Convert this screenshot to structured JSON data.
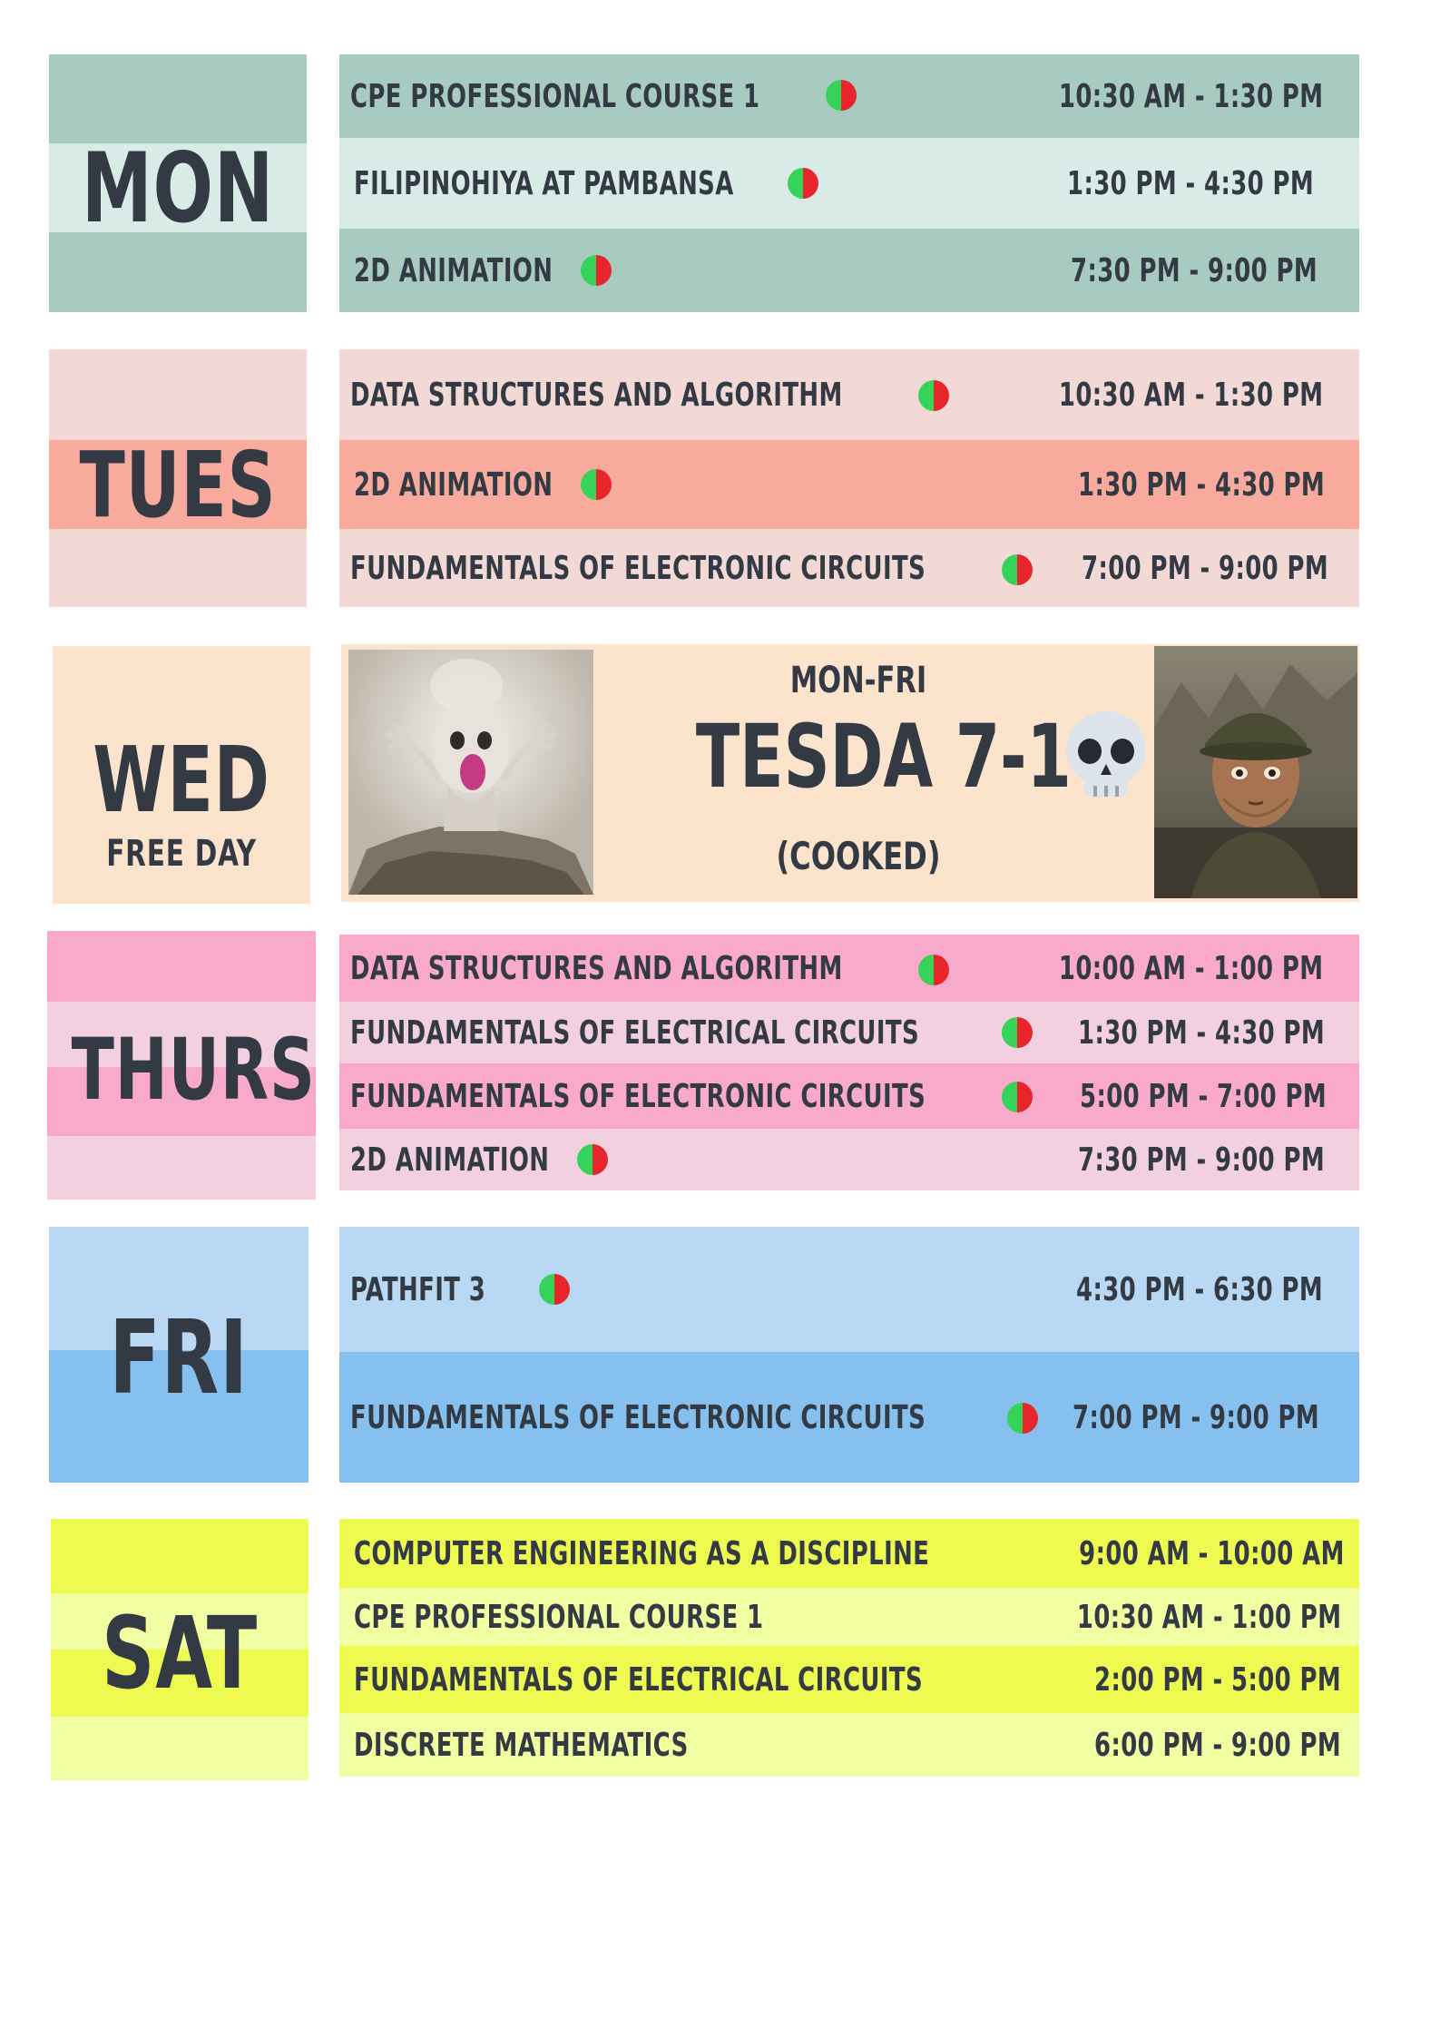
{
  "colors": {
    "mon_dark": "#a7cbc0",
    "mon_light": "#d9ebe6",
    "tue_light": "#f2d9d6",
    "tue_dark": "#f8aa9c",
    "wed": "#fce3cc",
    "thu_dark": "#f9aacb",
    "thu_light": "#f3d0e0",
    "fri_light": "#b8d8f3",
    "fri_dark": "#86c0ef",
    "sat_dark": "#eefa4f",
    "sat_light": "#f2fea2",
    "text": "#333a44",
    "dot_green": "#36d35a",
    "dot_red": "#e8252a"
  },
  "days": {
    "mon": {
      "label": "MON",
      "rows": [
        {
          "course": "CPE PROFESSIONAL COURSE 1",
          "time": "10:30 AM - 1:30 PM",
          "dot": true
        },
        {
          "course": "FILIPINOHIYA AT PAMBANSA",
          "time": "1:30 PM - 4:30 PM",
          "dot": true
        },
        {
          "course": "2D ANIMATION",
          "time": "7:30 PM - 9:00 PM",
          "dot": true
        }
      ]
    },
    "tue": {
      "label": "TUES",
      "rows": [
        {
          "course": "DATA STRUCTURES AND ALGORITHM",
          "time": "10:30 AM - 1:30 PM",
          "dot": true
        },
        {
          "course": "2D ANIMATION",
          "time": "1:30 PM - 4:30 PM",
          "dot": true
        },
        {
          "course": "FUNDAMENTALS OF ELECTRONIC CIRCUITS",
          "time": "7:00 PM - 9:00 PM",
          "dot": true
        }
      ]
    },
    "wed": {
      "label": "WED",
      "sublabel": "FREE DAY",
      "banner_top": "MON-FRI",
      "banner_title": "TESDA 7-1",
      "banner_emoji_icon": "skull-icon",
      "banner_bottom": "(COOKED)"
    },
    "thu": {
      "label": "THURS",
      "rows": [
        {
          "course": "DATA STRUCTURES AND ALGORITHM",
          "time": "10:00 AM - 1:00 PM",
          "dot": true
        },
        {
          "course": "FUNDAMENTALS OF ELECTRICAL CIRCUITS",
          "time": "1:30 PM - 4:30 PM",
          "dot": true
        },
        {
          "course": "FUNDAMENTALS OF ELECTRONIC CIRCUITS",
          "time": "5:00 PM - 7:00 PM",
          "dot": true
        },
        {
          "course": "2D ANIMATION",
          "time": "7:30 PM - 9:00 PM",
          "dot": true
        }
      ]
    },
    "fri": {
      "label": "FRI",
      "rows": [
        {
          "course": "PATHFIT 3",
          "time": "4:30 PM - 6:30 PM",
          "dot": true
        },
        {
          "course": "FUNDAMENTALS OF ELECTRONIC CIRCUITS",
          "time": "7:00 PM - 9:00 PM",
          "dot": true
        }
      ]
    },
    "sat": {
      "label": "SAT",
      "rows": [
        {
          "course": "COMPUTER ENGINEERING AS A DISCIPLINE",
          "time": "9:00 AM - 10:00 AM",
          "dot": false
        },
        {
          "course": "CPE PROFESSIONAL COURSE 1",
          "time": "10:30 AM - 1:00 PM",
          "dot": false
        },
        {
          "course": "FUNDAMENTALS OF ELECTRICAL CIRCUITS",
          "time": "2:00 PM - 5:00 PM",
          "dot": false
        },
        {
          "course": "DISCRETE MATHEMATICS",
          "time": "6:00 PM - 9:00 PM",
          "dot": false
        }
      ]
    }
  }
}
